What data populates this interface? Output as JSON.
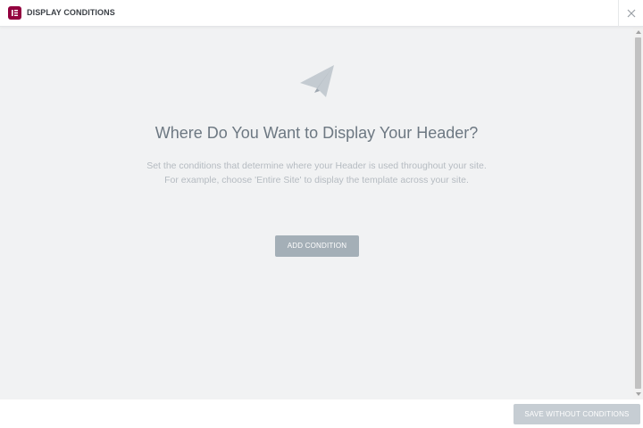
{
  "header": {
    "logo_icon": "elementor-logo-icon",
    "title": "DISPLAY CONDITIONS",
    "close_icon": "close-icon"
  },
  "main": {
    "illustration_icon": "paper-plane-icon",
    "heading": "Where Do You Want to Display Your Header?",
    "description_line1": "Set the conditions that determine where your Header is used throughout your site.",
    "description_line2": "For example, choose 'Entire Site' to display the template across your site.",
    "add_condition_label": "ADD CONDITION"
  },
  "footer": {
    "save_label": "SAVE WITHOUT CONDITIONS"
  },
  "colors": {
    "brand": "#93003f",
    "content_background": "#f1f2f3",
    "heading_text": "#6d7882",
    "description_text": "#b5bbc1",
    "add_button": "#a4afb7",
    "save_button_disabled": "#c6cdd3"
  }
}
